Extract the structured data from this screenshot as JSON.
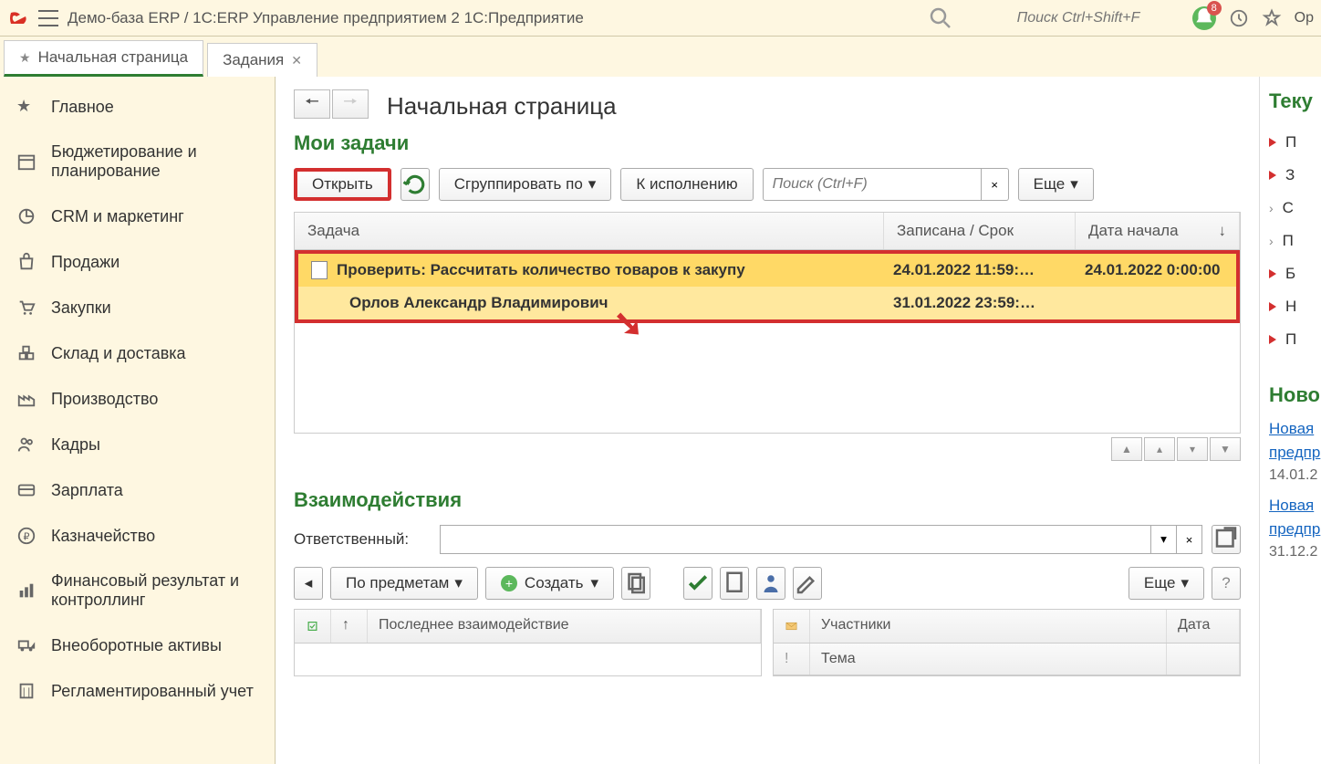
{
  "topbar": {
    "title": "Демо-база ERP / 1C:ERP Управление предприятием 2 1С:Предприятие",
    "search_placeholder": "Поиск Ctrl+Shift+F",
    "notif_count": "8",
    "user_truncated": "Ор"
  },
  "tabs": [
    {
      "label": "Начальная страница",
      "active": true,
      "closable": false
    },
    {
      "label": "Задания",
      "active": false,
      "closable": true
    }
  ],
  "sidebar": {
    "items": [
      "Главное",
      "Бюджетирование и планирование",
      "CRM и маркетинг",
      "Продажи",
      "Закупки",
      "Склад и доставка",
      "Производство",
      "Кадры",
      "Зарплата",
      "Казначейство",
      "Финансовый результат и контроллинг",
      "Внеоборотные активы",
      "Регламентированный учет"
    ]
  },
  "page": {
    "title": "Начальная страница"
  },
  "my_tasks": {
    "header": "Мои задачи",
    "open_btn": "Открыть",
    "group_btn": "Сгруппировать по",
    "execute_btn": "К исполнению",
    "search_placeholder": "Поиск (Ctrl+F)",
    "more_btn": "Еще",
    "columns": {
      "task": "Задача",
      "recorded": "Записана / Срок",
      "start": "Дата начала"
    },
    "rows": [
      {
        "title": "Проверить: Рассчитать количество товаров к закупу",
        "author": "Орлов Александр Владимирович",
        "recorded": "24.01.2022 11:59:…",
        "deadline": "31.01.2022 23:59:…",
        "start": "24.01.2022 0:00:00"
      }
    ]
  },
  "interactions": {
    "header": "Взаимодействия",
    "responsible_label": "Ответственный:",
    "by_subjects": "По предметам",
    "create_btn": "Создать",
    "more_btn": "Еще",
    "table1": {
      "col_last": "Последнее взаимодействие"
    },
    "table2": {
      "col_participants": "Участники",
      "col_date": "Дата",
      "col_subject": "Тема"
    }
  },
  "right": {
    "current_header": "Теку",
    "items": [
      "П",
      "З",
      "С",
      "П",
      "Б",
      "Н",
      "П"
    ],
    "news_header": "Ново",
    "news": [
      {
        "link": "Новая",
        "link2": "предпр",
        "date": "14.01.2"
      },
      {
        "link": "Новая",
        "link2": "предпр",
        "date": "31.12.2"
      }
    ]
  }
}
